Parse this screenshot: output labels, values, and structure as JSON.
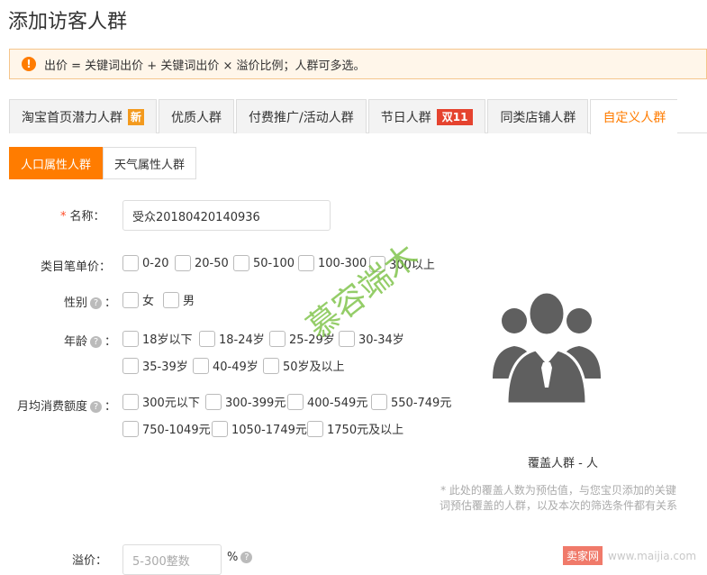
{
  "page_title": "添加访客人群",
  "notice": {
    "icon": "warning-icon",
    "text": "出价 = 关键词出价 + 关键词出价 × 溢价比例；人群可多选。"
  },
  "tabs": [
    {
      "label": "淘宝首页潜力人群",
      "badge": "新"
    },
    {
      "label": "优质人群",
      "badge": ""
    },
    {
      "label": "付费推广/活动人群",
      "badge": ""
    },
    {
      "label": "节日人群",
      "badge": "双11"
    },
    {
      "label": "同类店铺人群",
      "badge": ""
    },
    {
      "label": "自定义人群",
      "badge": ""
    }
  ],
  "subtabs": [
    "人口属性人群",
    "天气属性人群"
  ],
  "form": {
    "name": {
      "required_mark": "*",
      "label": "名称：",
      "value": "受众20180420140936"
    },
    "category_price": {
      "label": "类目笔单价：",
      "options": [
        "0-20",
        "20-50",
        "50-100",
        "100-300",
        "300以上"
      ]
    },
    "gender": {
      "label": "性别",
      "colon": "：",
      "options": [
        "女",
        "男"
      ]
    },
    "age": {
      "label": "年龄",
      "colon": "：",
      "options": [
        "18岁以下",
        "18-24岁",
        "25-29岁",
        "30-34岁",
        "35-39岁",
        "40-49岁",
        "50岁及以上"
      ]
    },
    "monthly_spend": {
      "label": "月均消费额度",
      "colon": "：",
      "options": [
        "300元以下",
        "300-399元",
        "400-549元",
        "550-749元",
        "750-1049元",
        "1050-1749元",
        "1750元及以上"
      ]
    },
    "premium": {
      "label": "溢价：",
      "placeholder": "5-300整数",
      "unit": "%"
    }
  },
  "coverage": {
    "text": "覆盖人群 - 人",
    "note": "* 此处的覆盖人数为预估值，与您宝贝添加的关键词预估覆盖的人群，以及本次的筛选条件都有关系"
  },
  "watermark": "慕容端木",
  "footer_watermark": {
    "logo": "卖家网",
    "url": "www.maijia.com"
  },
  "colors": {
    "accent": "#ff7c00",
    "notice_bg": "#fff6ea",
    "badge_new": "#f39a1e",
    "badge_d11": "#e5432f",
    "avatar": "#5f5f5f"
  }
}
